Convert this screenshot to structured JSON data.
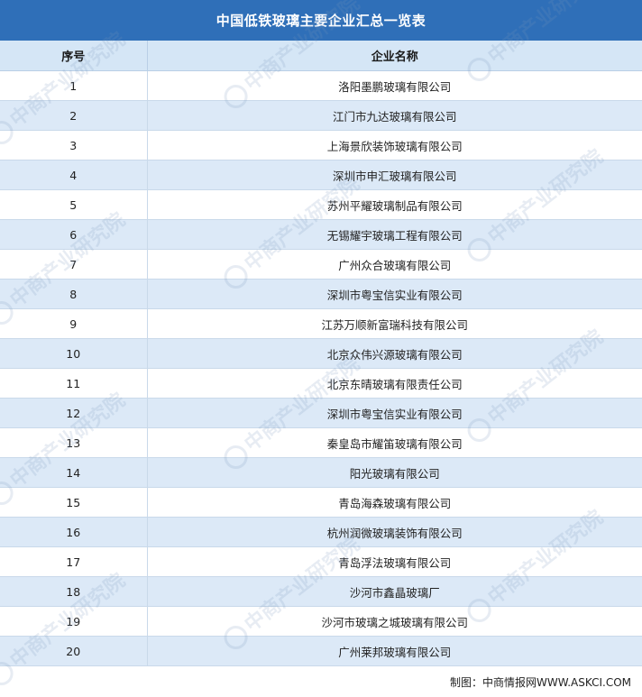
{
  "title": "中国低铁玻璃主要企业汇总一览表",
  "table": {
    "headers": {
      "index": "序号",
      "name": "企业名称"
    },
    "rows": [
      {
        "index": "1",
        "name": "洛阳墨鹏玻璃有限公司"
      },
      {
        "index": "2",
        "name": "江门市九达玻璃有限公司"
      },
      {
        "index": "3",
        "name": "上海景欣装饰玻璃有限公司"
      },
      {
        "index": "4",
        "name": "深圳市申汇玻璃有限公司"
      },
      {
        "index": "5",
        "name": "苏州平耀玻璃制品有限公司"
      },
      {
        "index": "6",
        "name": "无锡耀宇玻璃工程有限公司"
      },
      {
        "index": "7",
        "name": "广州众合玻璃有限公司"
      },
      {
        "index": "8",
        "name": "深圳市粤宝信实业有限公司"
      },
      {
        "index": "9",
        "name": "江苏万顺新富瑞科技有限公司"
      },
      {
        "index": "10",
        "name": "北京众伟兴源玻璃有限公司"
      },
      {
        "index": "11",
        "name": "北京东晴玻璃有限责任公司"
      },
      {
        "index": "12",
        "name": "深圳市粤宝信实业有限公司"
      },
      {
        "index": "13",
        "name": "秦皇岛市耀笛玻璃有限公司"
      },
      {
        "index": "14",
        "name": "阳光玻璃有限公司"
      },
      {
        "index": "15",
        "name": "青岛海森玻璃有限公司"
      },
      {
        "index": "16",
        "name": "杭州润微玻璃装饰有限公司"
      },
      {
        "index": "17",
        "name": "青岛浮法玻璃有限公司"
      },
      {
        "index": "18",
        "name": "沙河市鑫晶玻璃厂"
      },
      {
        "index": "19",
        "name": "沙河市玻璃之城玻璃有限公司"
      },
      {
        "index": "20",
        "name": "广州莱邦玻璃有限公司"
      }
    ]
  },
  "source": "制图：中商情报网WWW.ASKCI.COM",
  "watermark": "中商产业研究院",
  "colors": {
    "title_bg": "#2f6fb8",
    "header_bg": "#d5e6f6",
    "stripe_bg": "#dce9f7"
  }
}
